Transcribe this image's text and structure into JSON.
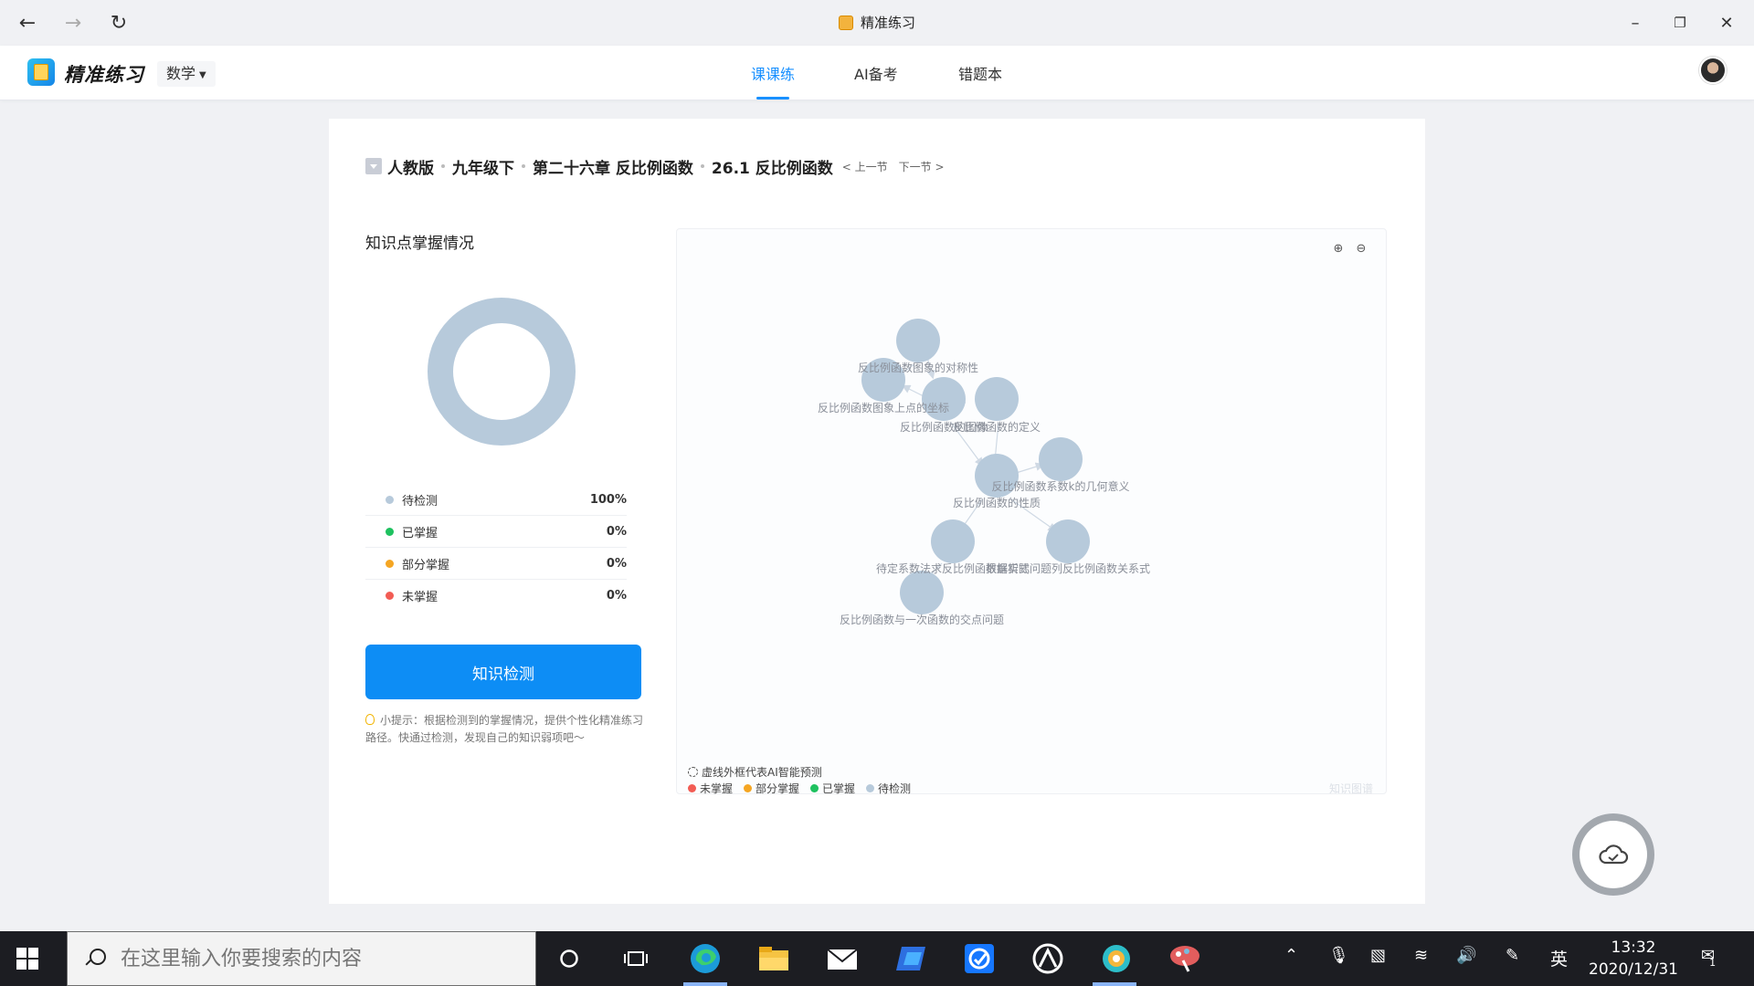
{
  "window": {
    "title": "精准练习"
  },
  "header": {
    "brand": "精准练习",
    "subject": "数学",
    "tabs": [
      {
        "label": "课课练",
        "active": true
      },
      {
        "label": "AI备考",
        "active": false
      },
      {
        "label": "错题本",
        "active": false
      }
    ]
  },
  "breadcrumb": {
    "items": [
      "人教版",
      "九年级下",
      "第二十六章 反比例函数",
      "26.1 反比例函数"
    ],
    "prev": "< 上一节",
    "next": "下一节 >"
  },
  "mastery": {
    "title": "知识点掌握情况",
    "legend": [
      {
        "label": "待检测",
        "value": "100%",
        "color": "#b7cadb"
      },
      {
        "label": "已掌握",
        "value": "0%",
        "color": "#1ec15f"
      },
      {
        "label": "部分掌握",
        "value": "0%",
        "color": "#f5a623"
      },
      {
        "label": "未掌握",
        "value": "0%",
        "color": "#f25c54"
      }
    ],
    "button_label": "知识检测",
    "tip": "小提示：根据检测到的掌握情况，提供个性化精准练习路径。快通过检测，发现自己的知识弱项吧～"
  },
  "graph": {
    "nodes": [
      {
        "id": "n1",
        "label": "反比例函数图象的对称性"
      },
      {
        "id": "n2",
        "label": "反比例函数图象上点的坐标"
      },
      {
        "id": "n3",
        "label": "反比例函数的图像"
      },
      {
        "id": "n4",
        "label": "反比例函数的定义"
      },
      {
        "id": "n5",
        "label": "反比例函数系数k的几何意义"
      },
      {
        "id": "n6",
        "label": "反比例函数的性质"
      },
      {
        "id": "n7",
        "label": "待定系数法求反比例函数解析式"
      },
      {
        "id": "n8",
        "label": "根据实际问题列反比例函数关系式"
      },
      {
        "id": "n9",
        "label": "反比例函数与一次函数的交点问题"
      }
    ],
    "note": "虚线外框代表AI智能预测",
    "legend": [
      {
        "label": "未掌握",
        "color": "#f25c54"
      },
      {
        "label": "部分掌握",
        "color": "#f5a623"
      },
      {
        "label": "已掌握",
        "color": "#1ec15f"
      },
      {
        "label": "待检测",
        "color": "#b7cadb"
      }
    ],
    "watermark": "知识图谱"
  },
  "taskbar": {
    "search_placeholder": "在这里输入你要搜索的内容",
    "ime": "英",
    "time": "13:32",
    "date": "2020/12/31",
    "notification_count": "1"
  }
}
